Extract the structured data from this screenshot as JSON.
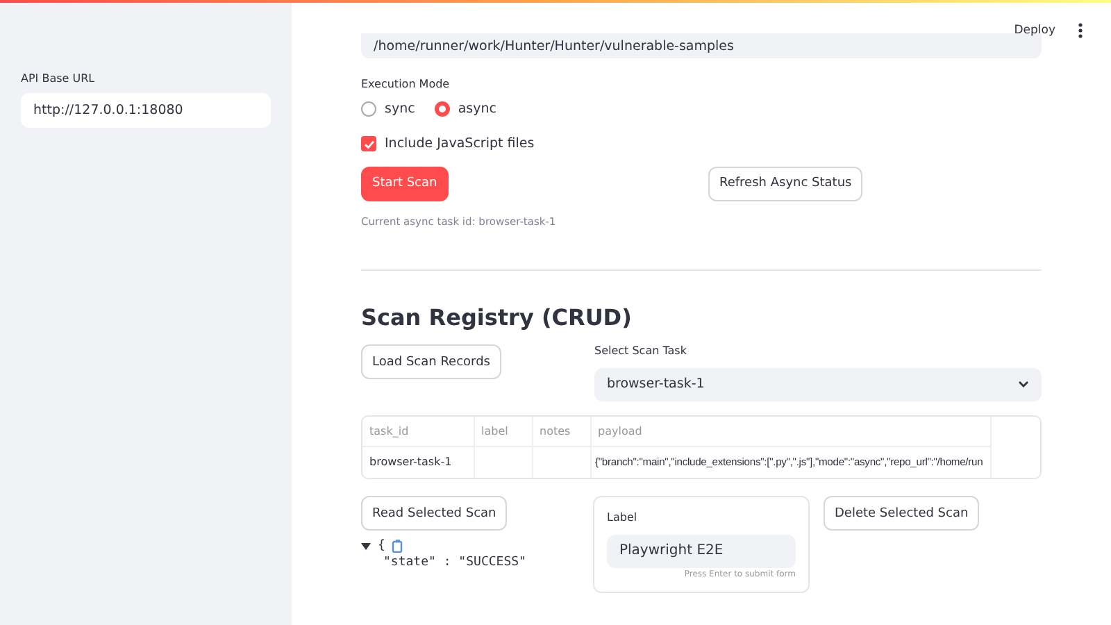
{
  "sidebar": {
    "api_base_url": {
      "label": "API Base URL",
      "value": "http://127.0.0.1:18080"
    }
  },
  "header": {
    "deploy": "Deploy"
  },
  "repo_path": {
    "value": "/home/runner/work/Hunter/Hunter/vulnerable-samples"
  },
  "execution_mode": {
    "label": "Execution Mode",
    "options": [
      {
        "label": "sync",
        "selected": false
      },
      {
        "label": "async",
        "selected": true
      }
    ]
  },
  "include_js": {
    "label": "Include JavaScript files",
    "checked": true
  },
  "buttons": [
    {
      "label": "Start Scan",
      "kind": "primary"
    },
    {
      "label": "Refresh Async Status",
      "kind": "secondary"
    }
  ],
  "async_task_caption": "Current async task id: browser-task-1",
  "registry": {
    "title": "Scan Registry (CRUD)",
    "load_button": "Load Scan Records",
    "select": {
      "label": "Select Scan Task",
      "value": "browser-task-1"
    },
    "table": {
      "columns": [
        "task_id",
        "label",
        "notes",
        "payload"
      ],
      "rows": [
        [
          "browser-task-1",
          "",
          "",
          "{\"branch\":\"main\",\"include_extensions\":[\".py\",\".js\"],\"mode\":\"async\",\"repo_url\":\"/home/run"
        ]
      ]
    },
    "read_button": "Read Selected Scan",
    "label_field": {
      "label": "Label",
      "value": "Playwright E2E",
      "hint": "Press Enter to submit form"
    },
    "delete_button": "Delete Selected Scan",
    "json_view": {
      "open_brace": "{",
      "line": "\"state\" : \"SUCCESS\""
    }
  }
}
